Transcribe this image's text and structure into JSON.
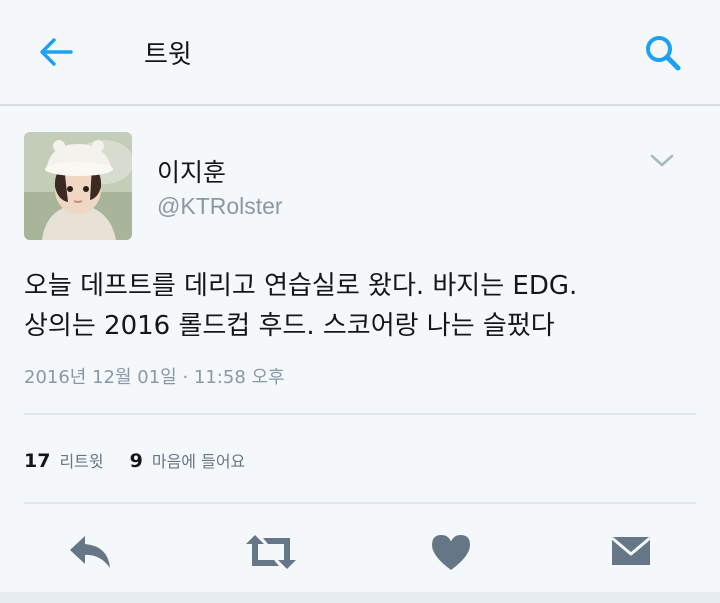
{
  "header": {
    "title": "트윗",
    "back_icon": "arrow-left-icon",
    "search_icon": "search-icon",
    "accent_color": "#1da1f2"
  },
  "tweet": {
    "display_name": "이지훈",
    "handle": "@KTRolster",
    "text_lines": [
      "오늘 데프트를 데리고 연습실로 왔다. 바지는 EDG.",
      "상의는 2016 롤드컵 후드. 스코어랑 나는 슬펐다"
    ],
    "timestamp": "2016년 12월 01일 · 11:58 오후"
  },
  "stats": {
    "retweet_count": "17",
    "retweet_label": "리트윗",
    "like_count": "9",
    "like_label": "마음에 들어요"
  },
  "actions": {
    "icons": [
      "reply-icon",
      "retweet-icon",
      "heart-icon",
      "direct-message-icon"
    ],
    "icon_color": "#657786"
  }
}
